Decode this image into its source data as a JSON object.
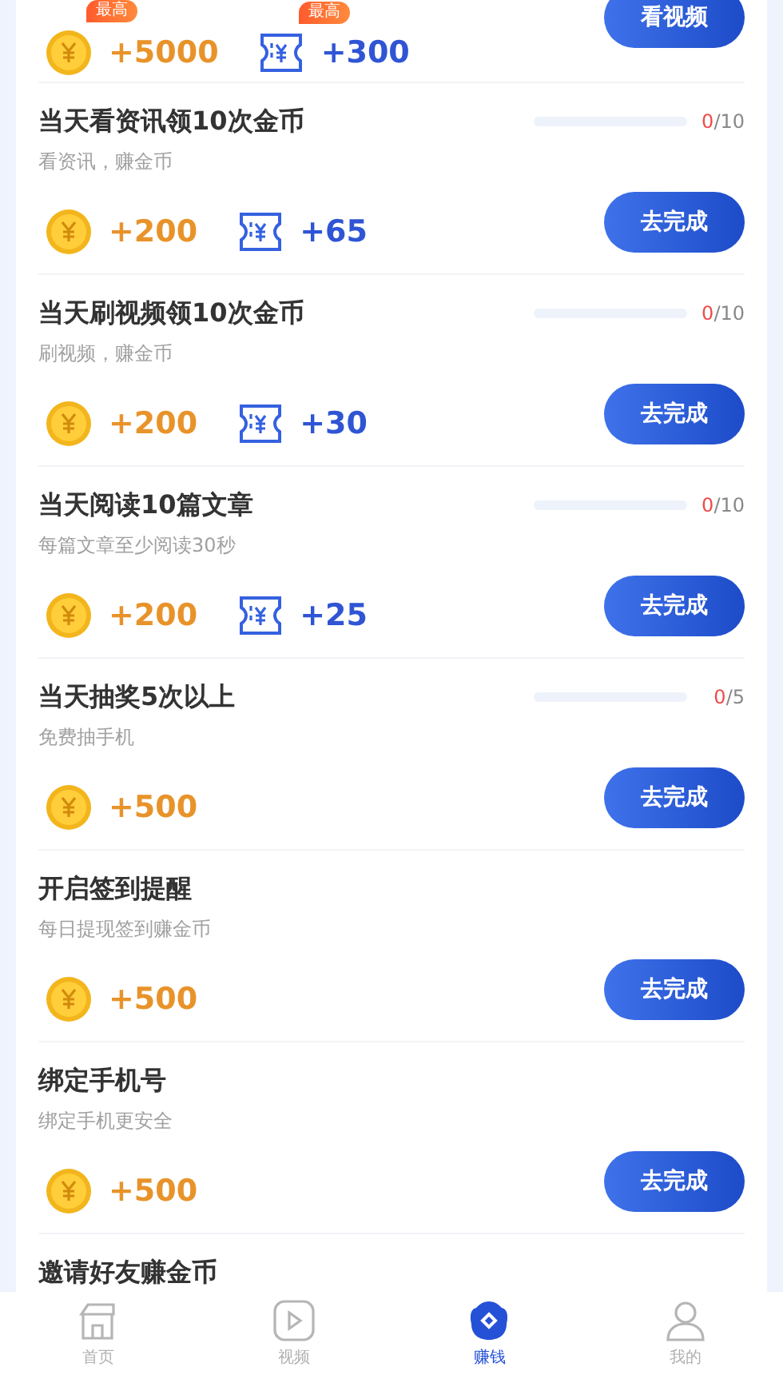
{
  "tasks": [
    {
      "rewards": [
        {
          "kind": "coin",
          "amount": "+5000",
          "badge": "最高"
        },
        {
          "kind": "ticket",
          "amount": "+300",
          "badge": "最高"
        }
      ],
      "button": "看视频"
    },
    {
      "title": "当天看资讯领10次金币",
      "subtitle": "看资讯，赚金币",
      "progress": {
        "done": "0",
        "total": "/10",
        "level": 0
      },
      "rewards": [
        {
          "kind": "coin",
          "amount": "+200"
        },
        {
          "kind": "ticket",
          "amount": "+65"
        }
      ],
      "button": "去完成"
    },
    {
      "title": "当天刷视频领10次金币",
      "subtitle": "刷视频，赚金币",
      "progress": {
        "done": "0",
        "total": "/10",
        "level": 0
      },
      "rewards": [
        {
          "kind": "coin",
          "amount": "+200"
        },
        {
          "kind": "ticket",
          "amount": "+30"
        }
      ],
      "button": "去完成"
    },
    {
      "title": "当天阅读10篇文章",
      "subtitle": "每篇文章至少阅读30秒",
      "progress": {
        "done": "0",
        "total": "/10",
        "level": 0
      },
      "rewards": [
        {
          "kind": "coin",
          "amount": "+200"
        },
        {
          "kind": "ticket",
          "amount": "+25"
        }
      ],
      "button": "去完成"
    },
    {
      "title": "当天抽奖5次以上",
      "subtitle": "免费抽手机",
      "progress": {
        "done": "0",
        "total": "/5",
        "level": 0
      },
      "rewards": [
        {
          "kind": "coin",
          "amount": "+500"
        }
      ],
      "button": "去完成"
    },
    {
      "title": "开启签到提醒",
      "subtitle": "每日提现签到赚金币",
      "rewards": [
        {
          "kind": "coin",
          "amount": "+500"
        }
      ],
      "button": "去完成"
    },
    {
      "title": "绑定手机号",
      "subtitle": "绑定手机更安全",
      "rewards": [
        {
          "kind": "coin",
          "amount": "+500"
        }
      ],
      "button": "去完成"
    },
    {
      "title": "邀请好友赚金币"
    }
  ],
  "nav": [
    {
      "kind": "home",
      "label": "首页",
      "selected": false
    },
    {
      "kind": "video",
      "label": "视频",
      "selected": false
    },
    {
      "kind": "earn",
      "label": "赚钱",
      "selected": true
    },
    {
      "kind": "profile",
      "label": "我的",
      "selected": false
    }
  ]
}
